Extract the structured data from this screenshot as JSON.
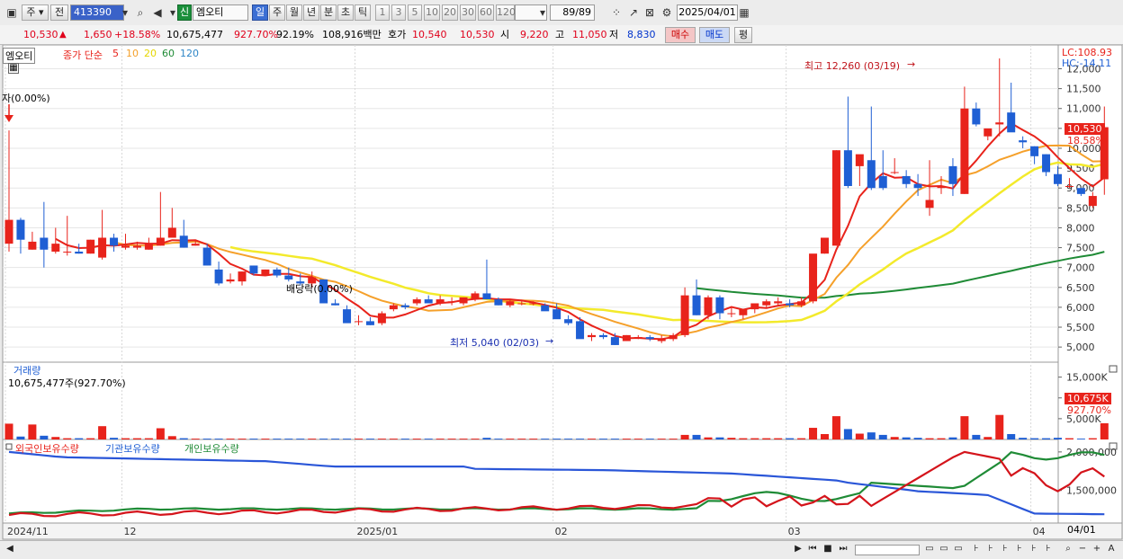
{
  "toolbar": {
    "market_label": "주",
    "prev_label": "전",
    "code": "413390",
    "badge": "신",
    "stock_name": "엠오티",
    "periods": [
      "일",
      "주",
      "월",
      "년",
      "분",
      "초",
      "틱"
    ],
    "active_period": "일",
    "intervals": [
      "1",
      "3",
      "5",
      "10",
      "20",
      "30",
      "60",
      "120"
    ],
    "count": "89/89",
    "date": "2025/04/01"
  },
  "quote": {
    "price": "10,530",
    "change": "1,650",
    "change_pct": "+18.58%",
    "volume": "10,675,477",
    "vol_ratio": "927.70%",
    "turnover_pct": "92.19%",
    "amount": "108,916백만",
    "hoga_label": "호가",
    "ask": "10,540",
    "bid": "10,530",
    "open_label": "시",
    "open": "9,220",
    "high_label": "고",
    "high": "11,050",
    "low_label": "저",
    "low": "8,830",
    "buy": "매수",
    "sell": "매도",
    "eval": "평"
  },
  "price_panel": {
    "name": "엠오티",
    "legend": [
      "종가 단순",
      "5",
      "10",
      "20",
      "60",
      "120"
    ],
    "lc_label": "LC:108.93",
    "hc_label": "HC:-14.11",
    "right_value": "10,530",
    "right_pct": "18.58%",
    "high_note": "최고 12,260 (03/19)",
    "low_note": "최저 5,040 (02/03)",
    "left_note": "자(0.00%)",
    "div_note": "배당락(0.00%)",
    "ylabels": [
      "12,000",
      "11,500",
      "11,000",
      "10,500",
      "10,000",
      "9,500",
      "9,000",
      "8,500",
      "8,000",
      "7,500",
      "7,000",
      "6,500",
      "6,000",
      "5,500",
      "5,000"
    ]
  },
  "volume_panel": {
    "title": "거래량",
    "info": "10,675,477주(927.70%)",
    "right_value": "10,675K",
    "right_pct": "927.70%",
    "ylabels": [
      "15,000K",
      "10,000K",
      "5,000K"
    ]
  },
  "holdings_panel": {
    "legend": [
      "외국인보유수량",
      "기관보유수량",
      "개인보유수량"
    ],
    "ylabels": [
      "2,000,000",
      "1,500,000"
    ]
  },
  "xaxis": {
    "labels": [
      "2024/11",
      "12",
      "2025/01",
      "02",
      "03",
      "04"
    ],
    "right_label": "04/01"
  },
  "colors": {
    "up": "#e8231b",
    "down": "#1f5fd4",
    "ma5": "#e8231b",
    "ma10": "#f5a02a",
    "ma20": "#f3ea2b",
    "ma60": "#1f8b36",
    "ma120": "#2f86c7"
  },
  "chart_data": {
    "type": "candlestick",
    "candles": [
      [
        7600,
        10450,
        7400,
        8200
      ],
      [
        8200,
        8250,
        7350,
        7700
      ],
      [
        7450,
        7900,
        7450,
        7650
      ],
      [
        7750,
        8650,
        7000,
        7450
      ],
      [
        7400,
        8000,
        7350,
        7600
      ],
      [
        7400,
        8300,
        7300,
        7400
      ],
      [
        7400,
        7600,
        7350,
        7350
      ],
      [
        7350,
        7700,
        7350,
        7700
      ],
      [
        7250,
        8450,
        7200,
        7750
      ],
      [
        7750,
        7850,
        7400,
        7550
      ],
      [
        7500,
        7850,
        7450,
        7550
      ],
      [
        7500,
        7650,
        7450,
        7550
      ],
      [
        7450,
        7750,
        7450,
        7600
      ],
      [
        7550,
        8900,
        7550,
        7750
      ],
      [
        7750,
        8500,
        7750,
        8000
      ],
      [
        7800,
        8200,
        7500,
        7500
      ],
      [
        7550,
        7700,
        7550,
        7600
      ],
      [
        7500,
        7600,
        7050,
        7050
      ],
      [
        6950,
        7150,
        6550,
        6600
      ],
      [
        6650,
        6850,
        6600,
        6700
      ],
      [
        6650,
        6900,
        6550,
        6900
      ],
      [
        7050,
        7050,
        6800,
        6850
      ],
      [
        6800,
        6950,
        6800,
        6950
      ],
      [
        6950,
        7000,
        6750,
        6800
      ],
      [
        6800,
        7000,
        6650,
        6700
      ],
      [
        6650,
        6850,
        6550,
        6600
      ],
      [
        6600,
        6900,
        6500,
        6750
      ],
      [
        6700,
        6700,
        6100,
        6100
      ],
      [
        6100,
        6200,
        6050,
        6050
      ],
      [
        5950,
        6050,
        5650,
        5600
      ],
      [
        5650,
        5800,
        5550,
        5650
      ],
      [
        5650,
        5750,
        5550,
        5550
      ],
      [
        5600,
        5900,
        5550,
        5850
      ],
      [
        5950,
        6100,
        5900,
        6050
      ],
      [
        6050,
        6100,
        5950,
        6000
      ],
      [
        6100,
        6250,
        6050,
        6200
      ],
      [
        6200,
        6300,
        6150,
        6100
      ],
      [
        6100,
        6300,
        6050,
        6200
      ],
      [
        6150,
        6250,
        6050,
        6150
      ],
      [
        6100,
        6200,
        6050,
        6250
      ],
      [
        6200,
        6400,
        6150,
        6350
      ],
      [
        6350,
        7200,
        6200,
        6200
      ],
      [
        6200,
        6250,
        6050,
        6050
      ],
      [
        6050,
        6200,
        6000,
        6150
      ],
      [
        6100,
        6150,
        6050,
        6100
      ],
      [
        6100,
        6150,
        6050,
        6100
      ],
      [
        6050,
        6100,
        5950,
        5900
      ],
      [
        5950,
        6100,
        5850,
        5700
      ],
      [
        5700,
        5800,
        5550,
        5600
      ],
      [
        5650,
        5750,
        5250,
        5200
      ],
      [
        5250,
        5350,
        5150,
        5300
      ],
      [
        5300,
        5350,
        5200,
        5250
      ],
      [
        5250,
        5350,
        5050,
        5050
      ],
      [
        5150,
        5300,
        5150,
        5300
      ],
      [
        5250,
        5300,
        5200,
        5250
      ],
      [
        5250,
        5300,
        5150,
        5200
      ],
      [
        5150,
        5300,
        5100,
        5200
      ],
      [
        5200,
        5350,
        5150,
        5300
      ],
      [
        5300,
        6500,
        5250,
        6300
      ],
      [
        6300,
        6700,
        5800,
        5800
      ],
      [
        5800,
        6300,
        5700,
        6250
      ],
      [
        6250,
        6300,
        5700,
        5850
      ],
      [
        5850,
        6000,
        5750,
        5850
      ],
      [
        5800,
        5950,
        5700,
        5950
      ],
      [
        5950,
        6100,
        5850,
        6100
      ],
      [
        6050,
        6200,
        6000,
        6150
      ],
      [
        6100,
        6250,
        6050,
        6150
      ],
      [
        6100,
        6200,
        6000,
        6050
      ],
      [
        6050,
        6250,
        6000,
        6150
      ],
      [
        6150,
        7300,
        6100,
        7350
      ],
      [
        7350,
        7750,
        7350,
        7750
      ],
      [
        7550,
        9950,
        7550,
        9950
      ],
      [
        9950,
        11300,
        9000,
        9050
      ],
      [
        9550,
        9700,
        9050,
        9850
      ],
      [
        9700,
        11050,
        8950,
        9000
      ],
      [
        9300,
        9950,
        8950,
        9000
      ],
      [
        9400,
        9750,
        9350,
        9400
      ],
      [
        9300,
        9450,
        9000,
        9100
      ],
      [
        9100,
        9350,
        8800,
        9000
      ],
      [
        8500,
        9700,
        8300,
        8700
      ],
      [
        9000,
        9300,
        8850,
        9050
      ],
      [
        9550,
        9750,
        8800,
        9100
      ],
      [
        8850,
        11550,
        8850,
        11000
      ],
      [
        11000,
        11150,
        10550,
        10600
      ],
      [
        10300,
        10450,
        10200,
        10500
      ],
      [
        10600,
        12260,
        10300,
        10650
      ],
      [
        10900,
        11650,
        10450,
        10400
      ],
      [
        10200,
        10300,
        10000,
        10150
      ],
      [
        10050,
        10050,
        9600,
        9800
      ],
      [
        9850,
        9850,
        9300,
        9400
      ],
      [
        9350,
        9550,
        9050,
        9100
      ],
      [
        9050,
        9250,
        9000,
        9050
      ],
      [
        9000,
        9000,
        8800,
        8850
      ],
      [
        8550,
        8900,
        8500,
        8800
      ],
      [
        9220,
        11050,
        8830,
        10530
      ]
    ],
    "volume": [
      3.8,
      0.7,
      3.6,
      0.9,
      0.6,
      0.3,
      0.3,
      0.3,
      3.2,
      0.4,
      0.3,
      0.3,
      0.3,
      2.7,
      0.8,
      0.3,
      0.2,
      0.2,
      0.2,
      0.2,
      0.2,
      0.2,
      0.2,
      0.2,
      0.2,
      0.2,
      0.2,
      0.2,
      0.2,
      0.2,
      0.2,
      0.2,
      0.2,
      0.2,
      0.2,
      0.2,
      0.2,
      0.2,
      0.2,
      0.2,
      0.2,
      0.4,
      0.2,
      0.2,
      0.2,
      0.2,
      0.2,
      0.2,
      0.2,
      0.2,
      0.2,
      0.2,
      0.2,
      0.2,
      0.2,
      0.2,
      0.2,
      0.2,
      1.1,
      1.1,
      0.5,
      0.5,
      0.4,
      0.3,
      0.3,
      0.3,
      0.3,
      0.3,
      0.3,
      2.8,
      1.3,
      5.6,
      2.5,
      1.4,
      1.7,
      1.1,
      0.6,
      0.5,
      0.4,
      0.3,
      0.3,
      0.5,
      5.6,
      1.1,
      0.6,
      5.9,
      1.3,
      0.4,
      0.3,
      0.3,
      0.4,
      0.3,
      0.2,
      0.3,
      3.9
    ],
    "ma5_color": "#e8231b"
  }
}
